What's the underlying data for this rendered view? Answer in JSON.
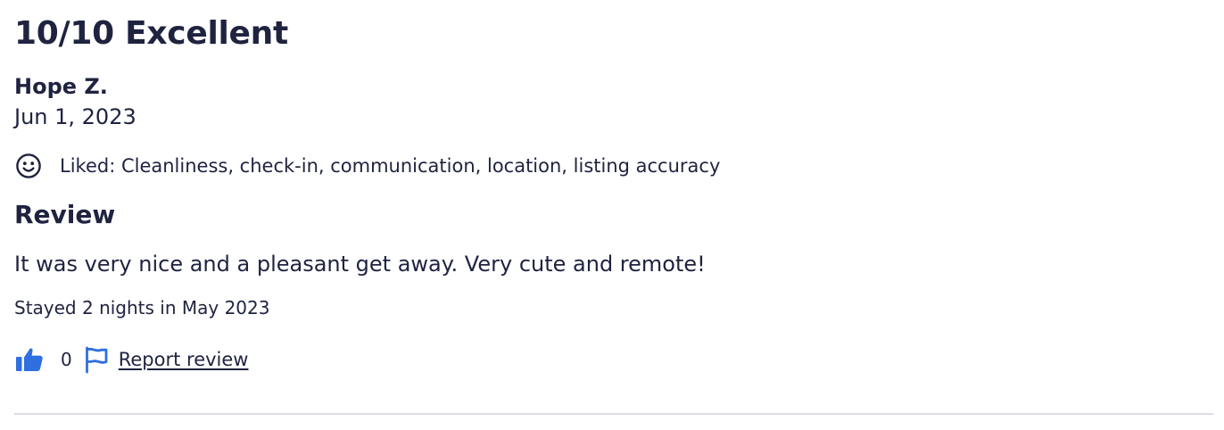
{
  "review": {
    "rating_heading": "10/10 Excellent",
    "reviewer_name": "Hope Z.",
    "date": "Jun 1, 2023",
    "liked": {
      "icon": "smile-icon",
      "text": "Liked: Cleanliness, check-in, communication, location, listing accuracy"
    },
    "section_heading": "Review",
    "body": "It was very nice and a pleasant get away. Very cute and remote!",
    "stay_info": "Stayed 2 nights in May 2023"
  },
  "actions": {
    "helpful_icon": "thumbs-up-icon",
    "helpful_count": "0",
    "report_icon": "flag-icon",
    "report_label": "Report review"
  },
  "colors": {
    "text": "#1f2340",
    "accent": "#2f6fdf",
    "divider": "#dcdde3"
  }
}
